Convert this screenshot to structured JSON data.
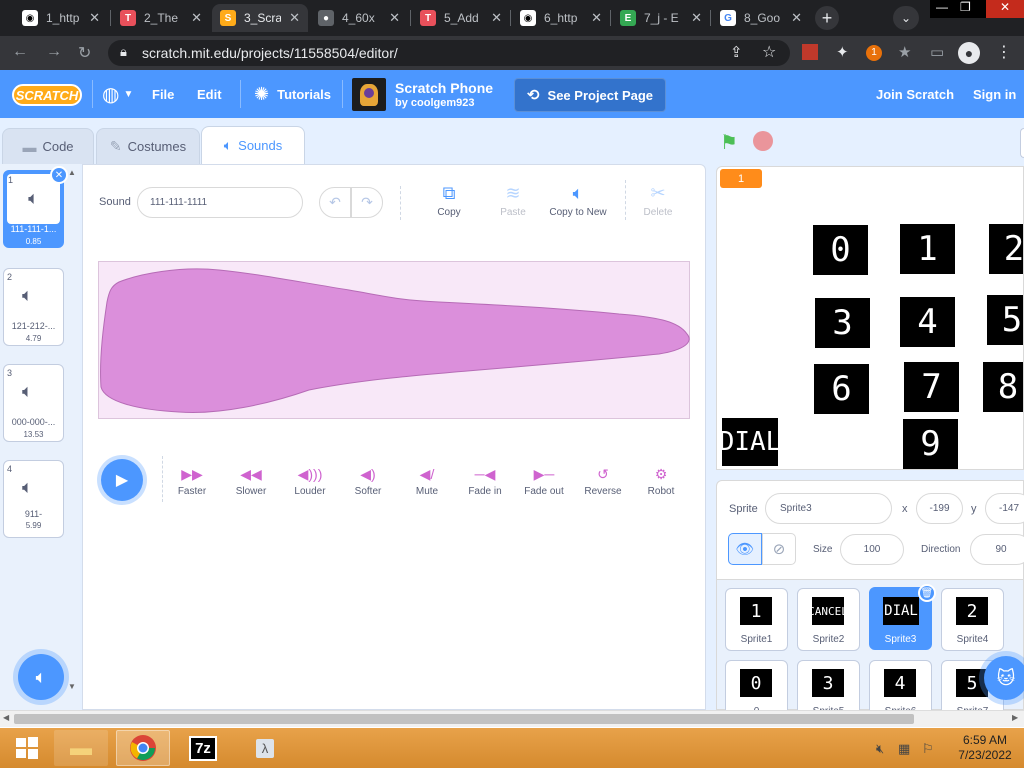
{
  "browser": {
    "tabs": [
      {
        "title": "1_http",
        "fav": "github",
        "color": "#fff"
      },
      {
        "title": "2_The",
        "fav": "T",
        "color": "#e8505b"
      },
      {
        "title": "3_Scra",
        "fav": "S",
        "color": "#ffab19",
        "active": true
      },
      {
        "title": "4_60x",
        "fav": "globe",
        "color": "#5f6368"
      },
      {
        "title": "5_Add",
        "fav": "T",
        "color": "#e8505b"
      },
      {
        "title": "6_http",
        "fav": "github",
        "color": "#fff"
      },
      {
        "title": "7_j - E",
        "fav": "E",
        "color": "#34a853"
      },
      {
        "title": "8_Goo",
        "fav": "G",
        "color": "#4285f4"
      }
    ],
    "url": "scratch.mit.edu/projects/11558504/editor/",
    "ext_badge": "1"
  },
  "menu": {
    "logo": "SCRATCH",
    "file": "File",
    "edit": "Edit",
    "tutorials": "Tutorials",
    "project_title": "Scratch Phone",
    "project_author": "by coolgem923",
    "see_project": "See Project Page",
    "join": "Join Scratch",
    "signin": "Sign in"
  },
  "editor_tabs": {
    "code": "Code",
    "costumes": "Costumes",
    "sounds": "Sounds"
  },
  "sounds": [
    {
      "num": "1",
      "name": "111-111-1...",
      "duration": "0.85",
      "selected": true
    },
    {
      "num": "2",
      "name": "121-212-...",
      "duration": "4.79"
    },
    {
      "num": "3",
      "name": "000-000-...",
      "duration": "13.53"
    },
    {
      "num": "4",
      "name": "911-",
      "duration": "5.99"
    }
  ],
  "sound_editor": {
    "label": "Sound",
    "name_value": "111-111-1111",
    "tools": {
      "copy": "Copy",
      "paste": "Paste",
      "copy_to_new": "Copy to New",
      "delete": "Delete"
    },
    "effects": [
      "Faster",
      "Slower",
      "Louder",
      "Softer",
      "Mute",
      "Fade in",
      "Fade out",
      "Reverse",
      "Robot"
    ]
  },
  "stage": {
    "variable": "1",
    "keys": [
      "0",
      "1",
      "2",
      "3",
      "4",
      "5",
      "6",
      "7",
      "8",
      "9",
      "DIAL"
    ]
  },
  "sprite_info": {
    "sprite_label": "Sprite",
    "sprite_name": "Sprite3",
    "x_label": "x",
    "x_value": "-199",
    "y_label": "y",
    "y_value": "-147",
    "size_label": "Size",
    "size_value": "100",
    "direction_label": "Direction",
    "direction_value": "90"
  },
  "sprites": [
    {
      "thumb": "1",
      "name": "Sprite1"
    },
    {
      "thumb": "CANCEL",
      "name": "Sprite2"
    },
    {
      "thumb": "DIAL",
      "name": "Sprite3",
      "selected": true
    },
    {
      "thumb": "2",
      "name": "Sprite4"
    },
    {
      "thumb": "0",
      "name": "0"
    },
    {
      "thumb": "3",
      "name": "Sprite5"
    },
    {
      "thumb": "4",
      "name": "Sprite6"
    },
    {
      "thumb": "5",
      "name": "Sprite7"
    }
  ],
  "taskbar": {
    "time": "6:59 AM",
    "date": "7/23/2022",
    "app_7z": "7z"
  },
  "colors": {
    "scratch_blue": "#4c97ff",
    "sound_purple": "#cf63cf",
    "orange": "#ff8c1a"
  }
}
